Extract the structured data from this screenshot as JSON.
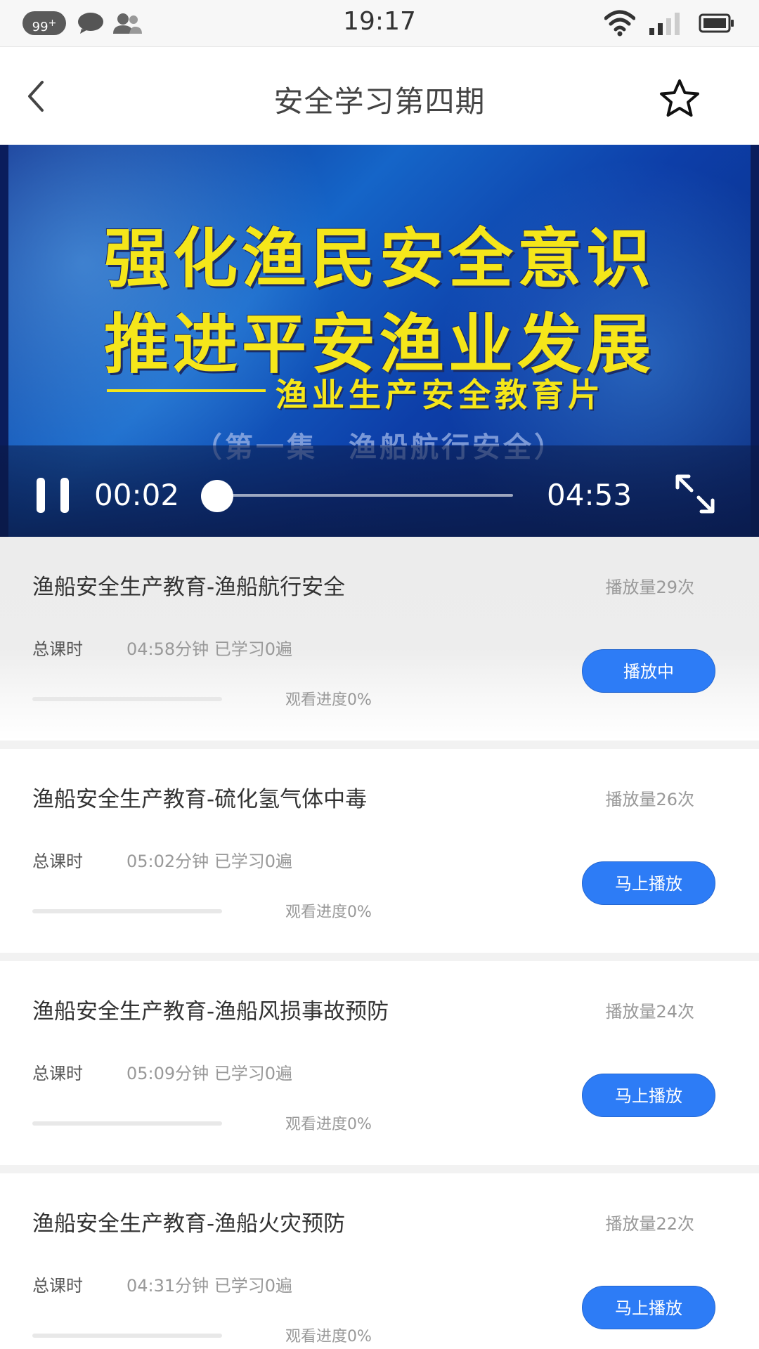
{
  "status_bar": {
    "badge": "99",
    "time": "19:17"
  },
  "nav": {
    "title": "安全学习第四期"
  },
  "video": {
    "overlay_line1": "强化渔民安全意识",
    "overlay_line2": "推进平安渔业发展",
    "overlay_subtitle": "渔业生产安全教育片",
    "overlay_episode": "（第一集　渔船航行安全）",
    "current_time": "00:02",
    "total_time": "04:53",
    "progress_fraction": 0.007
  },
  "list": {
    "items": [
      {
        "title": "渔船安全生产教育-渔船航行安全",
        "plays": "播放量29次",
        "total_label": "总课时",
        "duration": "04:58分钟 已学习0遍",
        "progress_text": "观看进度0%",
        "progress_fraction": 0,
        "button": "播放中",
        "active": true
      },
      {
        "title": "渔船安全生产教育-硫化氢气体中毒",
        "plays": "播放量26次",
        "total_label": "总课时",
        "duration": "05:02分钟 已学习0遍",
        "progress_text": "观看进度0%",
        "progress_fraction": 0,
        "button": "马上播放",
        "active": false
      },
      {
        "title": "渔船安全生产教育-渔船风损事故预防",
        "plays": "播放量24次",
        "total_label": "总课时",
        "duration": "05:09分钟 已学习0遍",
        "progress_text": "观看进度0%",
        "progress_fraction": 0,
        "button": "马上播放",
        "active": false
      },
      {
        "title": "渔船安全生产教育-渔船火灾预防",
        "plays": "播放量22次",
        "total_label": "总课时",
        "duration": "04:31分钟 已学习0遍",
        "progress_text": "观看进度0%",
        "progress_fraction": 0,
        "button": "马上播放",
        "active": false
      }
    ]
  }
}
